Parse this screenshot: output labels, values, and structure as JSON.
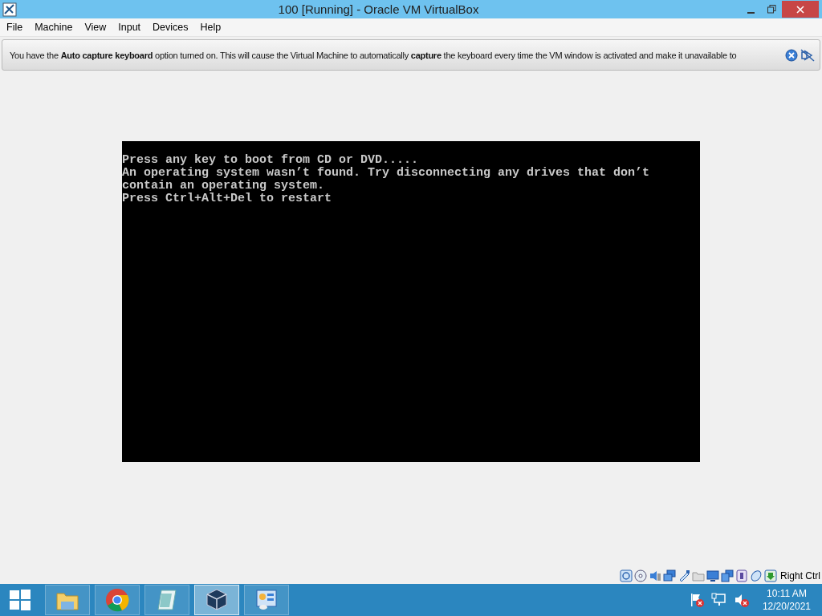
{
  "window": {
    "title": "100 [Running] - Oracle VM VirtualBox"
  },
  "menu": [
    {
      "label": "File"
    },
    {
      "label": "Machine"
    },
    {
      "label": "View"
    },
    {
      "label": "Input"
    },
    {
      "label": "Devices"
    },
    {
      "label": "Help"
    }
  ],
  "notice": {
    "text": "You have the **Auto capture keyboard** option turned on. This will cause the Virtual Machine to automatically **capture** the keyboard every time the VM window is activated and make it unavailable to"
  },
  "console": {
    "lines": [
      "Press any key to boot from CD or DVD.....",
      "An operating system wasn’t found. Try disconnecting any drives that don’t",
      "contain an operating system.",
      "Press Ctrl+Alt+Del to restart"
    ]
  },
  "status_bar": {
    "host_key": "Right Ctrl"
  },
  "taskbar": {
    "apps": [
      {
        "kind": "folder",
        "selected": false
      },
      {
        "kind": "browser",
        "selected": false
      },
      {
        "kind": "notepad",
        "selected": false
      },
      {
        "kind": "vbox",
        "selected": true
      },
      {
        "kind": "panel",
        "selected": false
      }
    ],
    "clock": {
      "time": "10:11 AM",
      "date": "12/20/2021"
    }
  }
}
